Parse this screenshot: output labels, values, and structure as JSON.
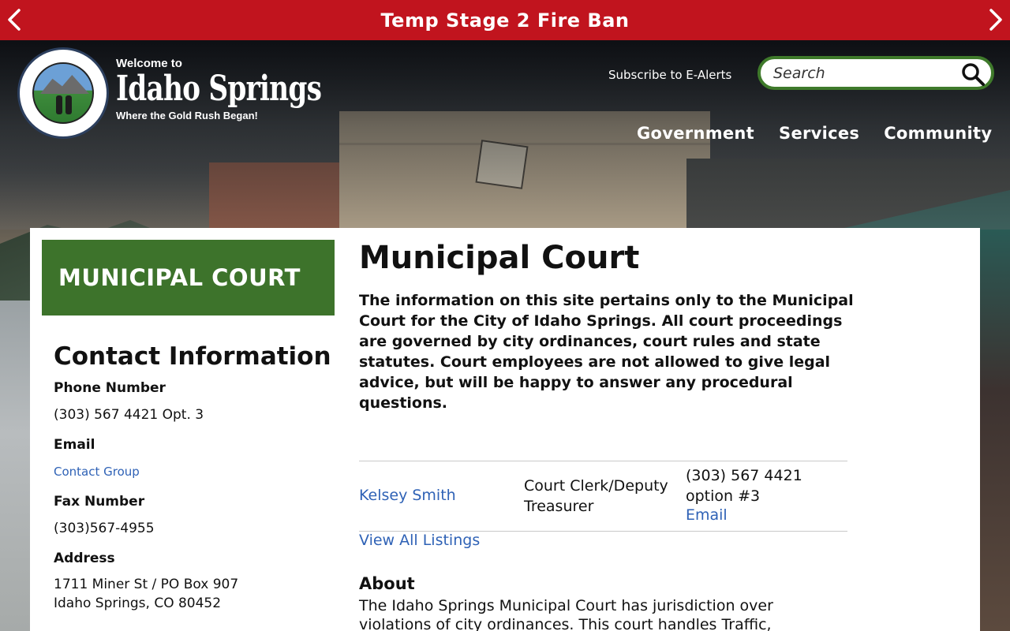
{
  "alert": {
    "title": "Temp Stage 2 Fire Ban",
    "prev_icon": "chevron-left-icon",
    "next_icon": "chevron-right-icon"
  },
  "header": {
    "welcome": "Welcome to",
    "site_name": "Idaho Springs",
    "tagline": "Where the Gold Rush Began!",
    "subscribe_label": "Subscribe to E-Alerts",
    "search_placeholder": "Search",
    "search_icon": "search-icon",
    "accent_color": "#3f7a2b",
    "nav": [
      "Government",
      "Services",
      "Community"
    ]
  },
  "sidebar": {
    "section_title": "MUNICIPAL COURT",
    "contact_heading": "Contact Information",
    "phone_label": "Phone Number",
    "phone_value": "(303) 567 4421 Opt. 3",
    "email_label": "Email",
    "email_link": "Contact Group",
    "fax_label": "Fax Number",
    "fax_value": "(303)567-4955",
    "address_label": "Address",
    "address_line1": "1711 Miner St / PO Box 907",
    "address_line2": "Idaho Springs, CO 80452"
  },
  "main": {
    "title": "Municipal Court",
    "intro": "The information on this site pertains only to the Municipal Court for the City of Idaho Springs. All court proceedings are governed by city ordinances, court rules and state statutes. Court employees are not allowed to give legal advice, but will be happy to answer any procedural questions.",
    "staff": [
      {
        "name": "Kelsey Smith",
        "role": "Court Clerk/Deputy Treasurer",
        "phone": "(303) 567 4421 option #3",
        "email_label": "Email"
      }
    ],
    "view_all": "View All Listings",
    "about_heading": "About",
    "about_text": "The Idaho Springs Municipal Court has jurisdiction over violations of city ordinances. This court handles Traffic,"
  },
  "colors": {
    "alert_red": "#c1141e",
    "sidebar_green": "#3d732b",
    "link_blue": "#2f62b6"
  }
}
